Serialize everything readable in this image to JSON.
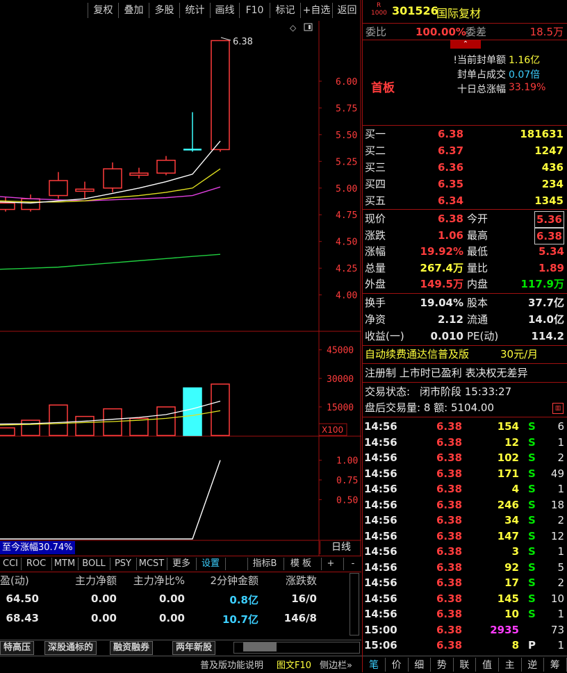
{
  "toolbar": [
    "复权",
    "叠加",
    "多股",
    "统计",
    "画线",
    "F10",
    "标记",
    "+自选",
    "返回"
  ],
  "stock": {
    "code": "301526",
    "name": "国际复材",
    "badge_r": "R",
    "badge_n": "1000"
  },
  "commission": {
    "ratio_label": "委比",
    "ratio": "100.00%",
    "diff_label": "委差",
    "diff": "18.5万"
  },
  "seal": {
    "tag": "首板",
    "items": [
      {
        "label": "当前封单额",
        "value": "1.16亿"
      },
      {
        "label": "封单占成交",
        "value": "0.07倍"
      },
      {
        "label": "十日总涨幅",
        "value": "33.19%"
      }
    ]
  },
  "bids": [
    {
      "label": "买一",
      "price": "6.38",
      "vol": "181631"
    },
    {
      "label": "买二",
      "price": "6.37",
      "vol": "1247"
    },
    {
      "label": "买三",
      "price": "6.36",
      "vol": "436"
    },
    {
      "label": "买四",
      "price": "6.35",
      "vol": "234"
    },
    {
      "label": "买五",
      "price": "6.34",
      "vol": "1345"
    }
  ],
  "quote": [
    {
      "l1": "现价",
      "v1": "6.38",
      "l2": "今开",
      "v2": "5.36"
    },
    {
      "l1": "涨跌",
      "v1": "1.06",
      "l2": "最高",
      "v2": "6.38"
    },
    {
      "l1": "涨幅",
      "v1": "19.92%",
      "l2": "最低",
      "v2": "5.34"
    },
    {
      "l1": "总量",
      "v1": "267.4万",
      "l2": "量比",
      "v2": "1.89"
    },
    {
      "l1": "外盘",
      "v1": "149.5万",
      "l2": "内盘",
      "v2": "117.9万"
    }
  ],
  "fund": [
    {
      "l1": "换手",
      "v1": "19.04%",
      "l2": "股本",
      "v2": "37.7亿"
    },
    {
      "l1": "净资",
      "v1": "2.12",
      "l2": "流通",
      "v2": "14.0亿"
    },
    {
      "l1": "收益(一)",
      "v1": "0.010",
      "l2": "PE(动)",
      "v2": "114.2"
    }
  ],
  "banner": {
    "text": "自动续费通达信普及版",
    "price": "30元/月"
  },
  "notice": "注册制 上市时已盈利 表决权无差异",
  "status": {
    "label": "交易状态:",
    "value": "闭市阶段 15:33:27"
  },
  "after": {
    "text": "盘后交易量: 8  额: 5104.00"
  },
  "ticks": [
    {
      "t": "14:56",
      "p": "6.38",
      "v": "154",
      "s": "S",
      "n": "6"
    },
    {
      "t": "14:56",
      "p": "6.38",
      "v": "12",
      "s": "S",
      "n": "1"
    },
    {
      "t": "14:56",
      "p": "6.38",
      "v": "102",
      "s": "S",
      "n": "2"
    },
    {
      "t": "14:56",
      "p": "6.38",
      "v": "171",
      "s": "S",
      "n": "49"
    },
    {
      "t": "14:56",
      "p": "6.38",
      "v": "4",
      "s": "S",
      "n": "1"
    },
    {
      "t": "14:56",
      "p": "6.38",
      "v": "246",
      "s": "S",
      "n": "18"
    },
    {
      "t": "14:56",
      "p": "6.38",
      "v": "34",
      "s": "S",
      "n": "2"
    },
    {
      "t": "14:56",
      "p": "6.38",
      "v": "147",
      "s": "S",
      "n": "12"
    },
    {
      "t": "14:56",
      "p": "6.38",
      "v": "3",
      "s": "S",
      "n": "1"
    },
    {
      "t": "14:56",
      "p": "6.38",
      "v": "92",
      "s": "S",
      "n": "5"
    },
    {
      "t": "14:56",
      "p": "6.38",
      "v": "17",
      "s": "S",
      "n": "2"
    },
    {
      "t": "14:56",
      "p": "6.38",
      "v": "145",
      "s": "S",
      "n": "10"
    },
    {
      "t": "14:56",
      "p": "6.38",
      "v": "10",
      "s": "S",
      "n": "1"
    },
    {
      "t": "15:00",
      "p": "6.38",
      "v": "2935",
      "s": "",
      "n": "73"
    },
    {
      "t": "15:06",
      "p": "6.38",
      "v": "8",
      "s": "P",
      "n": "1"
    }
  ],
  "bottom_tabs": [
    "笔",
    "价",
    "细",
    "势",
    "联",
    "值",
    "主",
    "逆",
    "筹"
  ],
  "chart": {
    "price_ticks": [
      "6.00",
      "5.75",
      "5.50",
      "5.25",
      "5.00",
      "4.75",
      "4.50",
      "4.25",
      "4.00"
    ],
    "high_label": "6.38",
    "vol_ticks": [
      "45000",
      "30000",
      "15000"
    ],
    "vol_unit": "X100",
    "ind_ticks": [
      "1.00",
      "0.75",
      "0.50"
    ],
    "period": "日线",
    "gain_label": "至今涨幅30.74%",
    "indicators": [
      "CCI",
      "ROC",
      "MTM",
      "BOLL",
      "PSY",
      "MCST",
      "更多",
      "设置"
    ],
    "ind_right": [
      "指标B",
      "模 板",
      "+",
      "-"
    ]
  },
  "table": {
    "headers": [
      "盈(动)",
      "主力净额",
      "主力净比%",
      "2分钟金额",
      "涨跌数"
    ],
    "rows": [
      [
        "64.50",
        "0.00",
        "0.00",
        "0.8亿",
        "16/0"
      ],
      [
        "68.43",
        "0.00",
        "0.00",
        "10.7亿",
        "146/8"
      ]
    ]
  },
  "sheet_tabs": [
    "特高压",
    "深股通标的",
    "融资融券",
    "两年新股"
  ],
  "footer": {
    "help": "普及版功能说明",
    "graph": "图文F10",
    "side": "侧边栏»"
  },
  "chart_data": {
    "type": "candlestick",
    "y_range": [
      3.9,
      6.5
    ],
    "candles": [
      {
        "o": 4.8,
        "c": 4.86,
        "h": 4.92,
        "l": 4.78
      },
      {
        "o": 4.8,
        "c": 4.9,
        "h": 4.94,
        "l": 4.78
      },
      {
        "o": 4.93,
        "c": 5.07,
        "h": 5.15,
        "l": 4.9
      },
      {
        "o": 4.97,
        "c": 4.99,
        "h": 5.06,
        "l": 4.9
      },
      {
        "o": 5.0,
        "c": 5.18,
        "h": 5.24,
        "l": 4.96
      },
      {
        "o": 5.12,
        "c": 5.14,
        "h": 5.19,
        "l": 5.09
      },
      {
        "o": 5.14,
        "c": 5.26,
        "h": 5.3,
        "l": 5.12
      },
      {
        "o": 5.36,
        "c": 5.36,
        "h": 5.71,
        "l": 5.34
      },
      {
        "o": 5.36,
        "c": 6.38,
        "h": 6.38,
        "l": 5.34
      }
    ],
    "volumes": [
      4000,
      8000,
      16000,
      10000,
      14000,
      9000,
      15000,
      25000,
      27000
    ],
    "indicator": [
      0,
      0,
      0,
      0,
      0,
      0,
      0,
      0,
      1.0
    ]
  }
}
